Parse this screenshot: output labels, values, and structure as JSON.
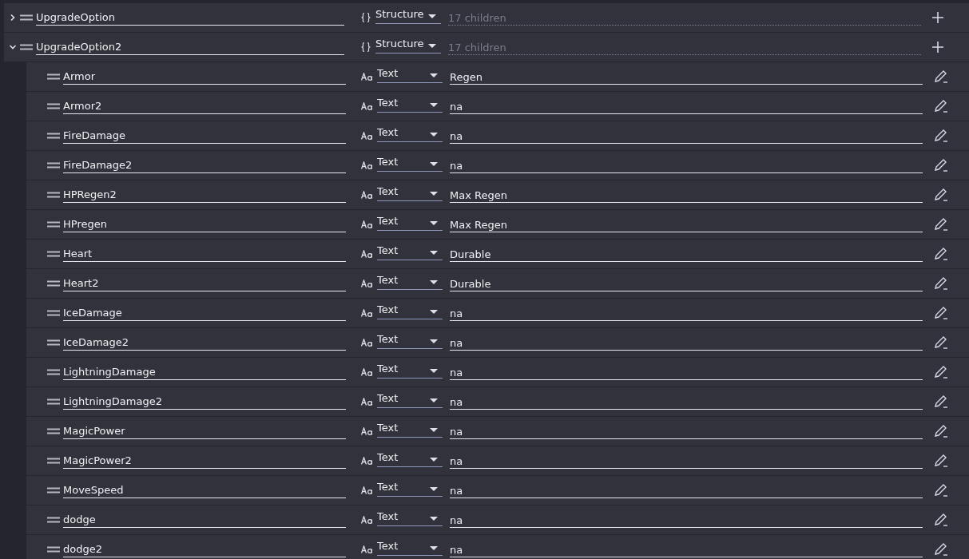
{
  "entries": [
    {
      "name": "UpgradeOption",
      "type": "Structure",
      "kind": "structure",
      "summary": "17 children",
      "expanded": false
    },
    {
      "name": "UpgradeOption2",
      "type": "Structure",
      "kind": "structure",
      "summary": "17 children",
      "expanded": true,
      "children": [
        {
          "name": "Armor",
          "type": "Text",
          "kind": "text",
          "value": "Regen"
        },
        {
          "name": "Armor2",
          "type": "Text",
          "kind": "text",
          "value": "na"
        },
        {
          "name": "FireDamage",
          "type": "Text",
          "kind": "text",
          "value": "na"
        },
        {
          "name": "FireDamage2",
          "type": "Text",
          "kind": "text",
          "value": "na"
        },
        {
          "name": "HPRegen2",
          "type": "Text",
          "kind": "text",
          "value": "Max Regen"
        },
        {
          "name": "HPregen",
          "type": "Text",
          "kind": "text",
          "value": "Max Regen"
        },
        {
          "name": "Heart",
          "type": "Text",
          "kind": "text",
          "value": "Durable"
        },
        {
          "name": "Heart2",
          "type": "Text",
          "kind": "text",
          "value": "Durable"
        },
        {
          "name": "IceDamage",
          "type": "Text",
          "kind": "text",
          "value": "na"
        },
        {
          "name": "IceDamage2",
          "type": "Text",
          "kind": "text",
          "value": "na"
        },
        {
          "name": "LightningDamage",
          "type": "Text",
          "kind": "text",
          "value": "na"
        },
        {
          "name": "LightningDamage2",
          "type": "Text",
          "kind": "text",
          "value": "na"
        },
        {
          "name": "MagicPower",
          "type": "Text",
          "kind": "text",
          "value": "na"
        },
        {
          "name": "MagicPower2",
          "type": "Text",
          "kind": "text",
          "value": "na"
        },
        {
          "name": "MoveSpeed",
          "type": "Text",
          "kind": "text",
          "value": "na"
        },
        {
          "name": "dodge",
          "type": "Text",
          "kind": "text",
          "value": "na"
        },
        {
          "name": "dodge2",
          "type": "Text",
          "kind": "text",
          "value": "na"
        }
      ]
    }
  ]
}
